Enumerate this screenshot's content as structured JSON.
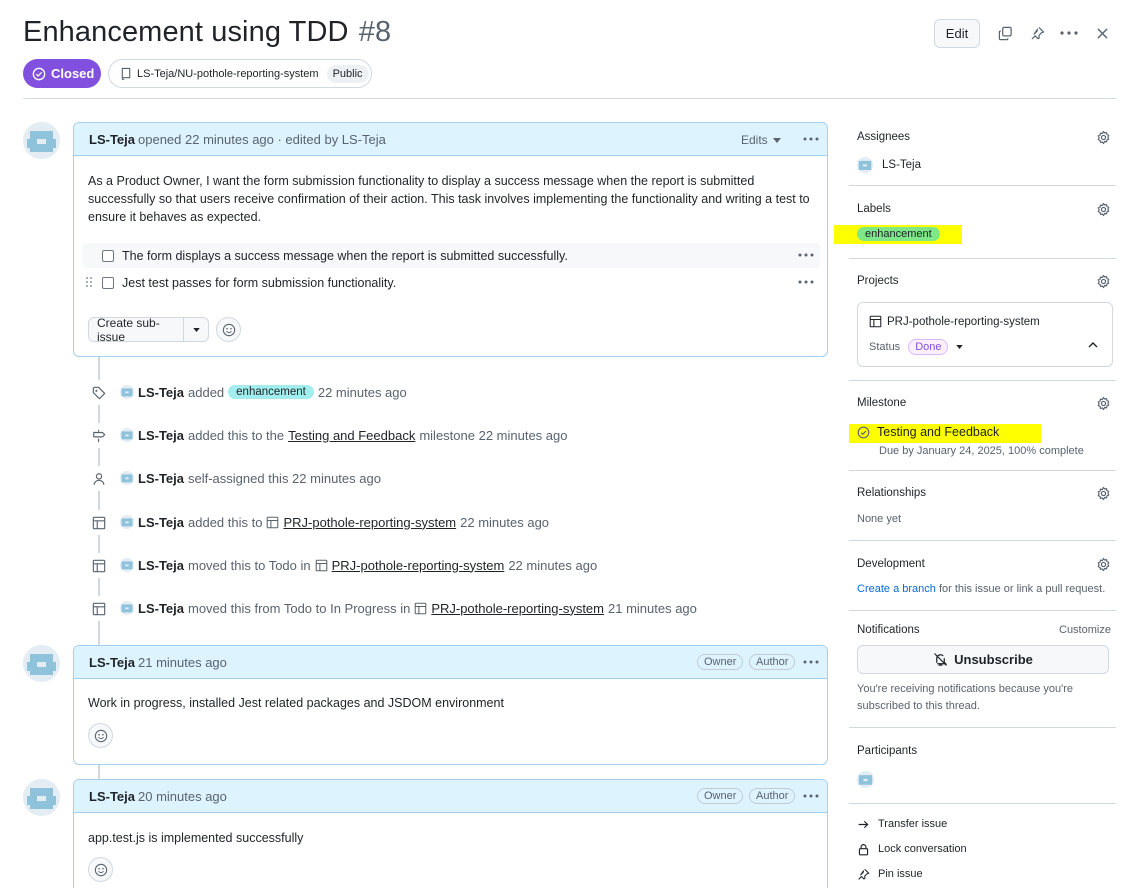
{
  "issue": {
    "title": "Enhancement using TDD",
    "number": "#8",
    "state": "Closed",
    "repo": "LS-Teja/NU-pothole-reporting-system",
    "visibility": "Public",
    "edit_label": "Edit"
  },
  "first_comment": {
    "author": "LS-Teja",
    "meta": "opened 22 minutes ago · edited by LS-Teja",
    "edits_label": "Edits",
    "body": "As a Product Owner, I want the form submission functionality to display a success message when the report is submitted successfully so that users receive confirmation of their action. This task involves implementing the functionality and writing a test to ensure it behaves as expected.",
    "tasks": [
      {
        "text": "The form displays a success message when the report is submitted successfully.",
        "checked": false
      },
      {
        "text": "Jest test passes for form submission functionality.",
        "checked": false
      }
    ],
    "create_sub_issue_label": "Create sub-issue"
  },
  "events": [
    {
      "icon": "tag-icon",
      "author": "LS-Teja",
      "pre": "added",
      "label": "enhancement",
      "post": "22 minutes ago"
    },
    {
      "icon": "milestone-icon",
      "author": "LS-Teja",
      "pre": "added this to the",
      "link": "Testing and Feedback",
      "post": "milestone 22 minutes ago"
    },
    {
      "icon": "person-icon",
      "author": "LS-Teja",
      "pre": "self-assigned this 22 minutes ago"
    },
    {
      "icon": "table-icon",
      "author": "LS-Teja",
      "pre": "added this to",
      "link": "PRJ-pothole-reporting-system",
      "post": "22 minutes ago"
    },
    {
      "icon": "table-icon",
      "author": "LS-Teja",
      "pre": "moved this to Todo in",
      "link": "PRJ-pothole-reporting-system",
      "post": "22 minutes ago"
    },
    {
      "icon": "table-icon",
      "author": "LS-Teja",
      "pre": "moved this from Todo to In Progress in",
      "link": "PRJ-pothole-reporting-system",
      "post": "21 minutes ago"
    }
  ],
  "comments": [
    {
      "author": "LS-Teja",
      "time": "21 minutes ago",
      "owner": "Owner",
      "role": "Author",
      "body": "Work in progress, installed Jest related packages and JSDOM environment"
    },
    {
      "author": "LS-Teja",
      "time": "20 minutes ago",
      "owner": "Owner",
      "role": "Author",
      "body": "app.test.js is implemented successfully"
    }
  ],
  "sidebar": {
    "assignees": {
      "heading": "Assignees",
      "name": "LS-Teja"
    },
    "labels": {
      "heading": "Labels",
      "label": "enhancement"
    },
    "projects": {
      "heading": "Projects",
      "name": "PRJ-pothole-reporting-system",
      "status_label": "Status",
      "status": "Done"
    },
    "milestone": {
      "heading": "Milestone",
      "name": "Testing and Feedback",
      "due": "Due by January 24, 2025, 100% complete"
    },
    "relationships": {
      "heading": "Relationships",
      "value": "None yet"
    },
    "development": {
      "heading": "Development",
      "link": "Create a branch",
      "rest": "for this issue or link a pull request."
    },
    "notifications": {
      "heading": "Notifications",
      "customize": "Customize",
      "button": "Unsubscribe",
      "note": "You're receiving notifications because you're subscribed to this thread."
    },
    "participants": {
      "heading": "Participants"
    },
    "actions": [
      "Transfer issue",
      "Lock conversation",
      "Pin issue"
    ]
  },
  "colors": {
    "accent_purple": "#8250df",
    "label_enhancement": "#a2eeef",
    "highlight": "#ffff00",
    "comment_header": "#ddf4ff"
  }
}
